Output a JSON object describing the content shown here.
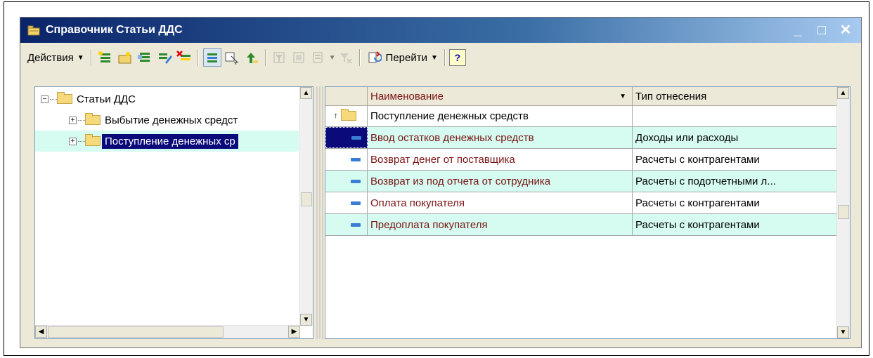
{
  "window": {
    "title": "Справочник Статьи ДДС",
    "minimize": "_",
    "maximize": "□",
    "close": "✕"
  },
  "toolbar": {
    "actions_label": "Действия",
    "goto_label": "Перейти",
    "help_label": "?"
  },
  "tree": {
    "root_label": "Статьи ДДС",
    "items": [
      {
        "label": "Выбытие денежных средст"
      },
      {
        "label": "Поступление денежных ср"
      }
    ]
  },
  "grid": {
    "columns": [
      "Наименование",
      "Тип отнесения"
    ],
    "parent_row": {
      "name": "Поступление денежных средств",
      "type": ""
    },
    "rows": [
      {
        "name": "Ввод остатков денежных средств",
        "type": "Доходы или расходы"
      },
      {
        "name": "Возврат денег от поставщика",
        "type": "Расчеты с контрагентами"
      },
      {
        "name": "Возврат из под отчета от сотрудника",
        "type": "Расчеты с подотчетными л..."
      },
      {
        "name": "Оплата покупателя",
        "type": "Расчеты с контрагентами"
      },
      {
        "name": "Предоплата покупателя",
        "type": "Расчеты с контрагентами"
      }
    ]
  },
  "colors": {
    "title_bar": "#0a246a",
    "selection": "#0a0a7a",
    "row_highlight": "#d6fbf0",
    "item_text": "#7a1414"
  }
}
